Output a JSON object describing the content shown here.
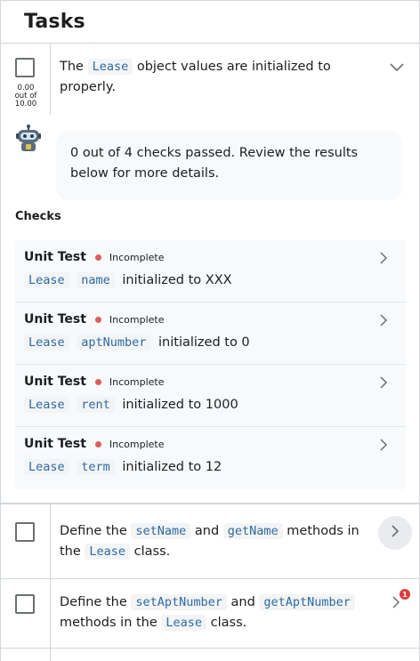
{
  "header": {
    "title": "Tasks"
  },
  "task1": {
    "text_before": "The",
    "code_class": "Lease",
    "text_after": "object values are initialized to properly.",
    "score_value": "0.00",
    "score_mid": "out of",
    "score_total": "10.00",
    "feedback": "0 out of 4 checks passed. Review the results below for more details.",
    "checks_title": "Checks",
    "checks": [
      {
        "type": "Unit Test",
        "status": "Incomplete",
        "code1": "Lease",
        "code2": "name",
        "text": "initialized to XXX"
      },
      {
        "type": "Unit Test",
        "status": "Incomplete",
        "code1": "Lease",
        "code2": "aptNumber",
        "text": "initialized to 0"
      },
      {
        "type": "Unit Test",
        "status": "Incomplete",
        "code1": "Lease",
        "code2": "rent",
        "text": "initialized to 1000"
      },
      {
        "type": "Unit Test",
        "status": "Incomplete",
        "code1": "Lease",
        "code2": "term",
        "text": "initialized to 12"
      }
    ]
  },
  "task2": {
    "t1": "Define the",
    "c1": "setName",
    "t2": "and",
    "c2": "getName",
    "t3": "methods in",
    "t4": "the",
    "c3": "Lease",
    "t5": "class."
  },
  "task3": {
    "t1": "Define the",
    "c1": "setAptNumber",
    "t2": "and",
    "c2": "getAptNumber",
    "t3": "methods in the",
    "c3": "Lease",
    "t4": "class.",
    "badge": "1"
  },
  "icons": {
    "chevron_down": "chevron-down-icon",
    "chevron_right": "chevron-right-icon",
    "robot": "robot-icon"
  },
  "colors": {
    "status_dot": "#e05d5d",
    "badge": "#e03b3b",
    "code_text": "#2d6a9f"
  }
}
